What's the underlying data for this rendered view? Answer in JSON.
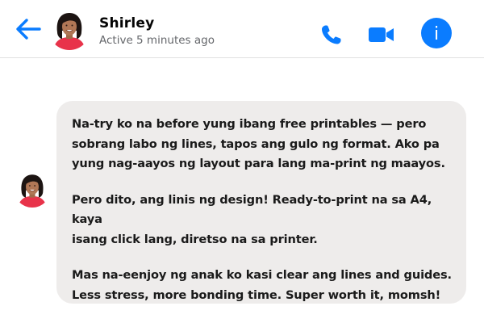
{
  "header": {
    "contact_name": "Shirley",
    "status": "Active 5 minutes ago",
    "back_icon": "back-arrow-icon",
    "call_icon": "phone-icon",
    "video_icon": "video-camera-icon",
    "info_icon": "info-icon",
    "info_glyph": "i"
  },
  "message": {
    "paragraphs": [
      "Na-try ko na before yung ibang free printables — pero\nsobrang labo ng lines, tapos ang gulo ng format. Ako pa\nyung nag-aayos ng layout para lang ma-print ng maayos.",
      "Pero dito, ang linis ng design! Ready-to-print na sa A4, kaya\nisang click lang, diretso na sa printer.",
      "Mas na-eenjoy ng anak ko kasi clear ang lines and guides.\nLess stress, more bonding time. Super worth it, momsh!"
    ]
  },
  "colors": {
    "accent": "#0a7cff",
    "bubble_background": "#eeeceb",
    "status_text": "#65676b",
    "avatar_ring": "#e8334a"
  }
}
